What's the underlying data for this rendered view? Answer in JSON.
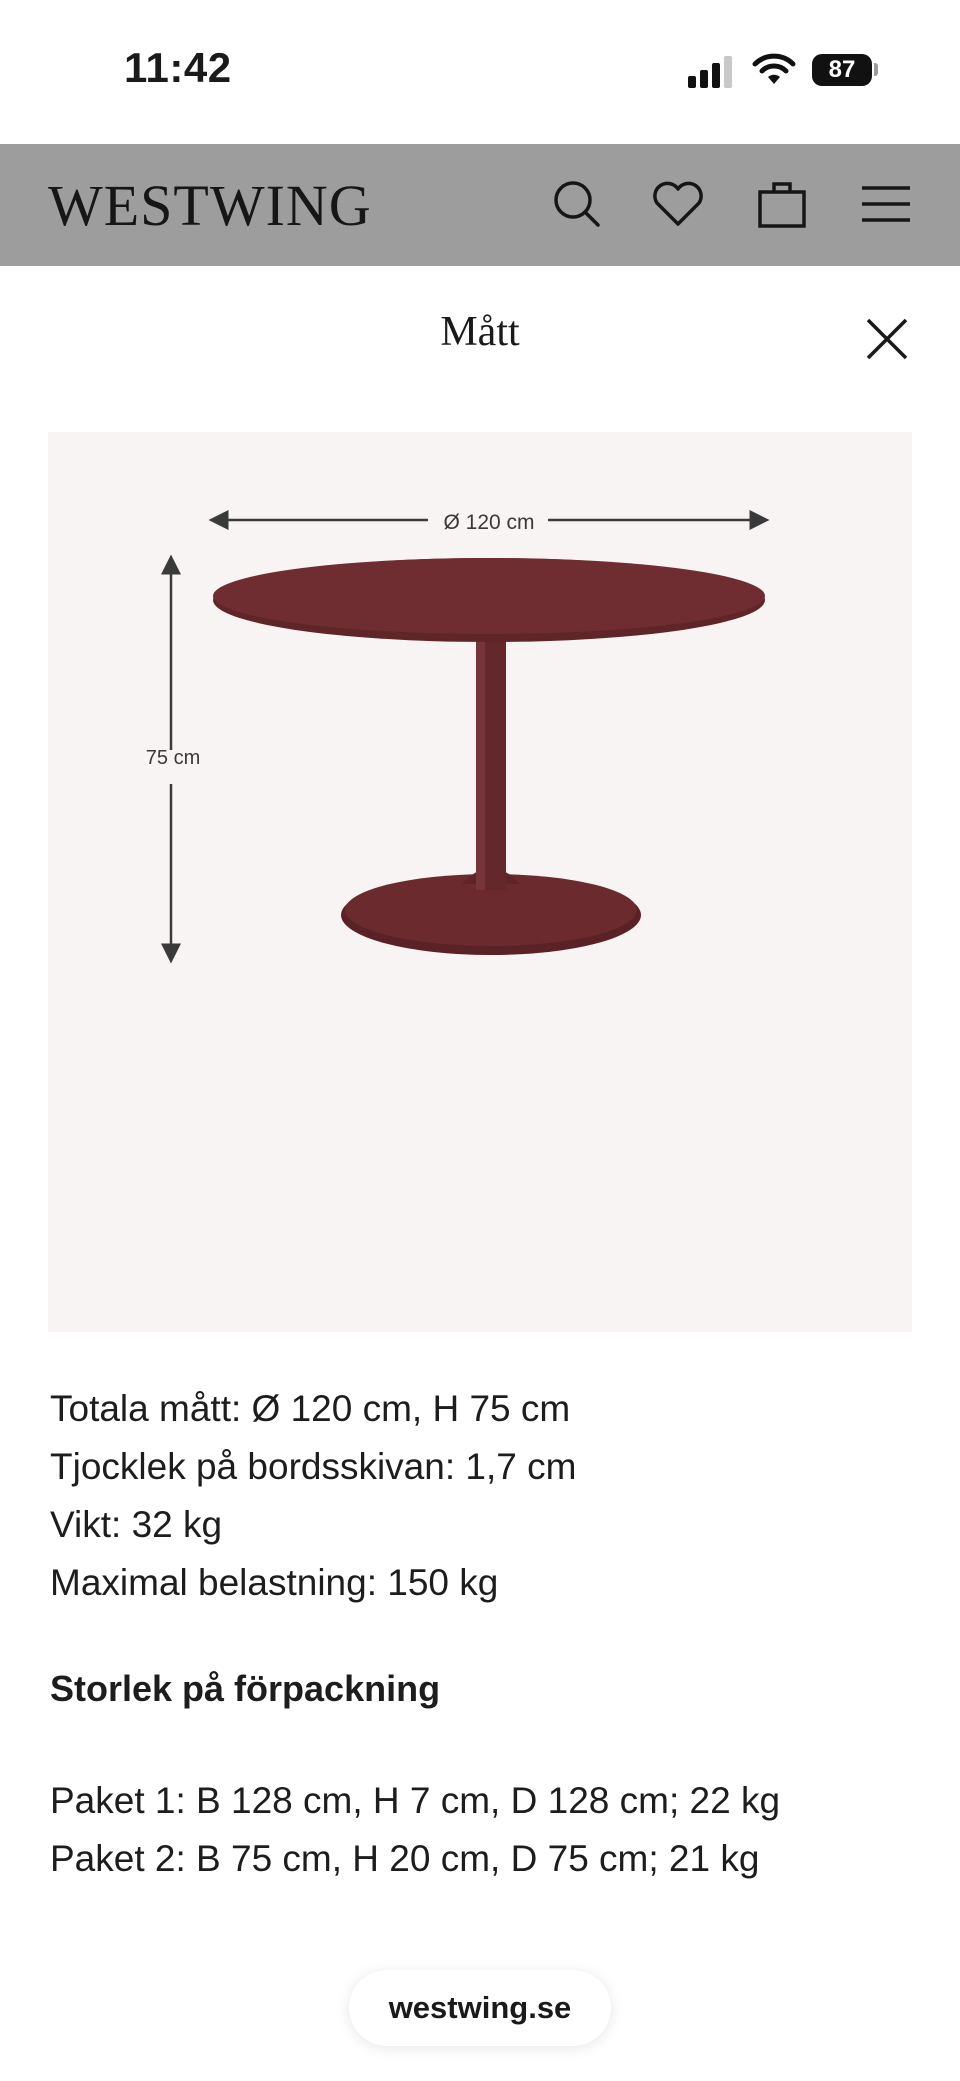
{
  "status_bar": {
    "time": "11:42",
    "battery": "87",
    "icons": [
      "signal-icon",
      "wifi-icon",
      "battery-icon"
    ]
  },
  "header": {
    "logo": "WESTWING",
    "icons": [
      "search-icon",
      "heart-icon",
      "bag-icon",
      "menu-icon"
    ]
  },
  "modal": {
    "title": "Mått",
    "close_icon": "close-icon"
  },
  "product_image": {
    "diameter_label": "Ø 120 cm",
    "height_label": "75 cm",
    "table_color": "#6b2a2e"
  },
  "specs": [
    "Totala mått: Ø 120 cm, H 75 cm",
    "Tjocklek på bordsskivan: 1,7 cm",
    "Vikt: 32 kg",
    "Maximal belastning: 150 kg"
  ],
  "packaging": {
    "heading": "Storlek på förpackning",
    "packages": [
      "Paket 1: B 128 cm, H 7 cm, D 128 cm; 22 kg",
      "Paket 2: B 75 cm, H 20 cm, D 75 cm; 21 kg"
    ]
  },
  "footer": {
    "domain": "westwing.se"
  },
  "colors": {
    "header_bg": "#9d9d9d",
    "image_bg": "#f7f4f3",
    "text": "#1d1d1d"
  }
}
